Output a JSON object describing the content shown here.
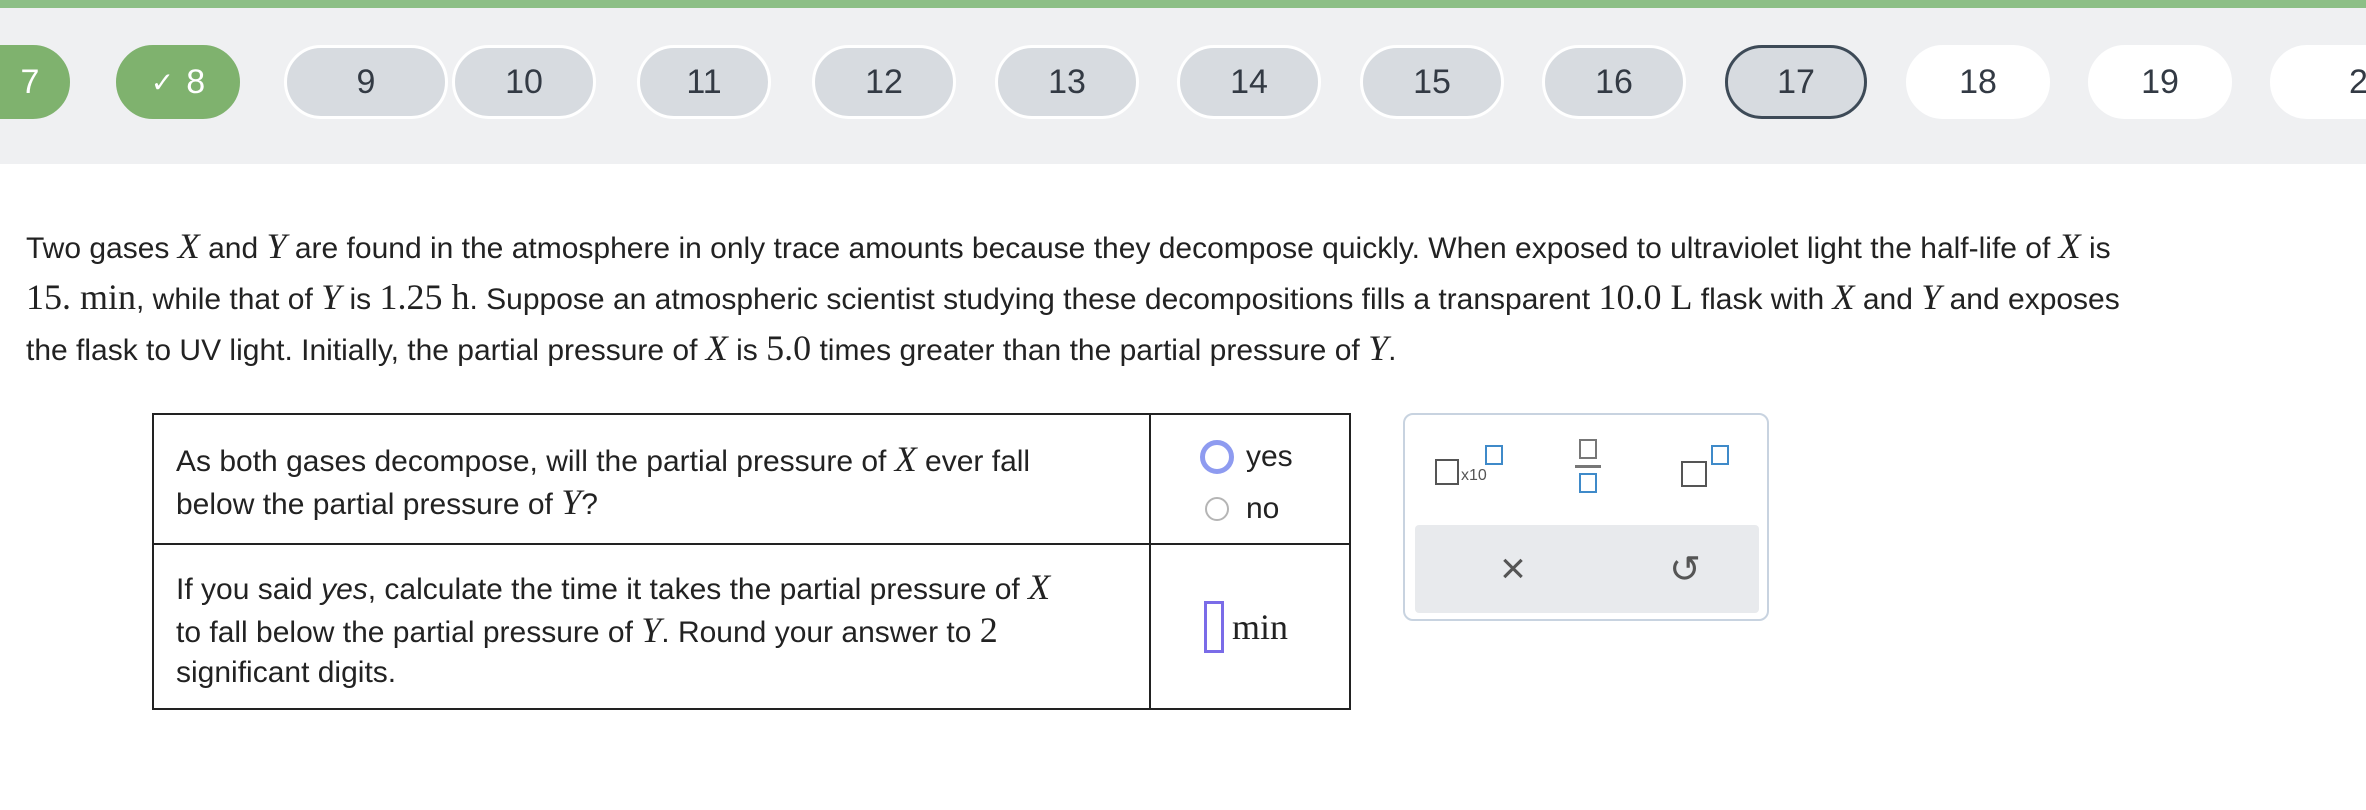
{
  "nav": {
    "items": [
      {
        "label": "7",
        "state": "done"
      },
      {
        "label": "8",
        "state": "done",
        "check": "✓"
      },
      {
        "label": "9",
        "state": "visited"
      },
      {
        "label": "10",
        "state": "visited"
      },
      {
        "label": "11",
        "state": "visited"
      },
      {
        "label": "12",
        "state": "visited"
      },
      {
        "label": "13",
        "state": "visited"
      },
      {
        "label": "14",
        "state": "visited"
      },
      {
        "label": "15",
        "state": "visited"
      },
      {
        "label": "16",
        "state": "visited"
      },
      {
        "label": "17",
        "state": "current"
      },
      {
        "label": "18",
        "state": "future"
      },
      {
        "label": "19",
        "state": "future"
      },
      {
        "label": "2",
        "state": "future"
      }
    ]
  },
  "question": {
    "s1": "Two gases ",
    "X": "X",
    "and": "and",
    "Y": "Y",
    "s2": " are found in the atmosphere in only trace amounts because they decompose quickly. When exposed to ultraviolet light the half-life of ",
    "s3": " is",
    "hx": "15. min",
    "s4": ", while that of ",
    "s5": " is ",
    "hy": "1.25 h",
    "s6": ". Suppose an atmospheric scientist studying these decompositions fills a transparent ",
    "vol": "10.0 L",
    "s7": " flask with ",
    "s8": " and exposes",
    "s9": "the flask to UV light. Initially, the partial pressure of ",
    "s10": " is ",
    "ratio": "5.0",
    "s11": " times greater than the partial pressure of ",
    "s12": "."
  },
  "table": {
    "q1_a": "As both gases decompose, will the partial pressure of ",
    "q1_b": " ever fall",
    "q1_c": "below the partial pressure of ",
    "q1_d": "?",
    "opt_yes": "yes",
    "opt_no": "no",
    "q2_a": "If you said ",
    "q2_yes": "yes",
    "q2_b": ", calculate the time it takes the partial pressure of ",
    "q2_c": "to fall below the partial pressure of ",
    "q2_d": ". Round your answer to ",
    "q2_digits": "2",
    "q2_e": "significant digits.",
    "unit": "min"
  },
  "keypad": {
    "x10_label": "x10",
    "clear_symbol": "×",
    "undo_symbol": "↺"
  },
  "colors": {
    "accent_green": "#7fb26e",
    "radio_selected": "#8e9bf0",
    "answer_box": "#7a6ce8"
  }
}
